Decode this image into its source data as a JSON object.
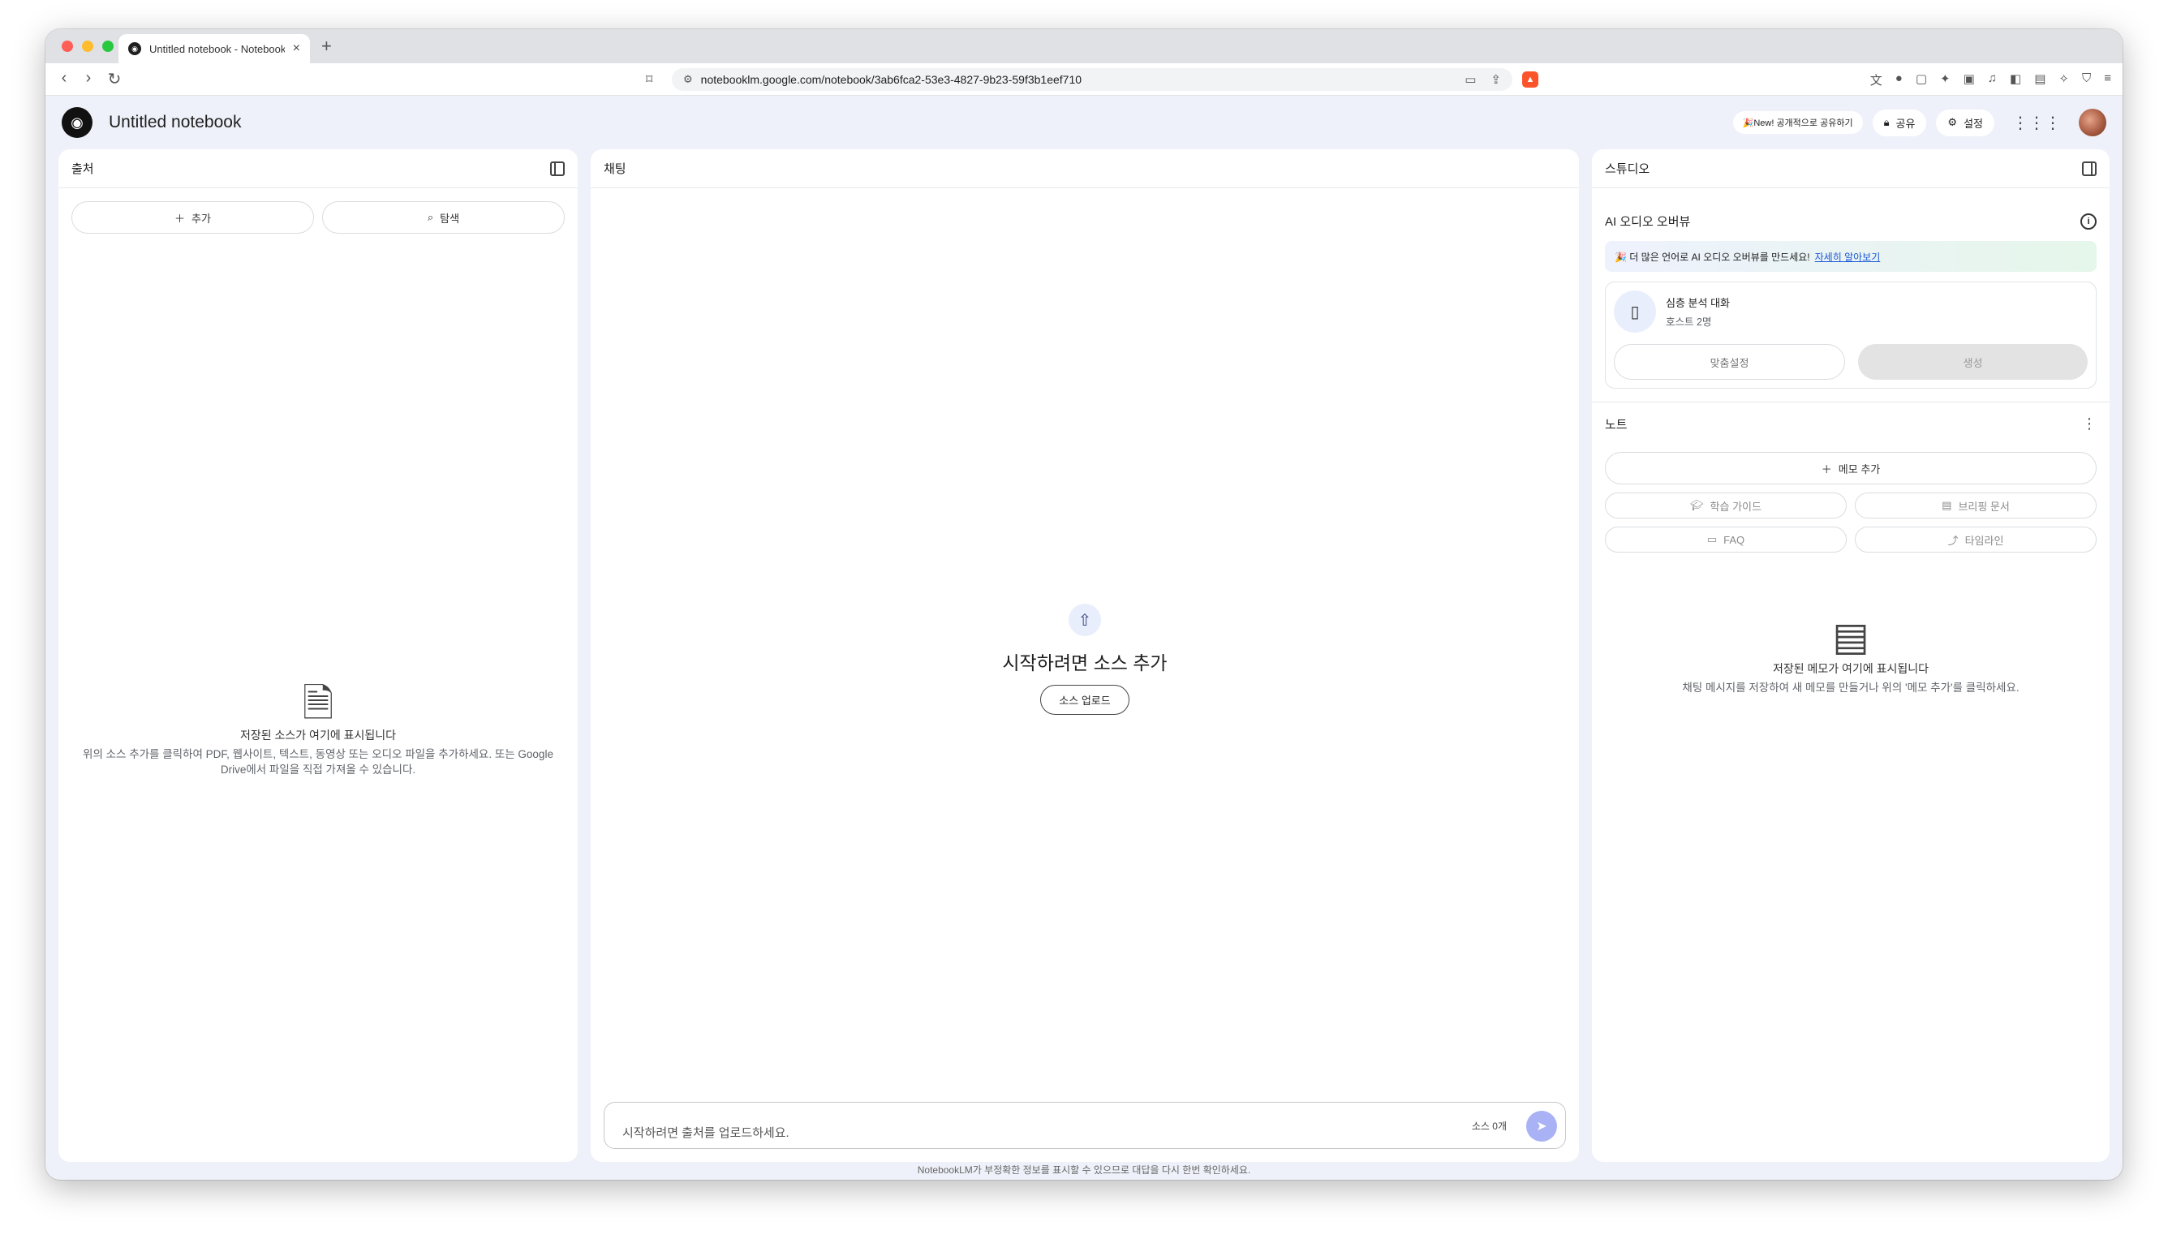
{
  "browser": {
    "tab_title": "Untitled notebook - NotebookLM",
    "tab_close": "×",
    "new_tab": "+",
    "url": "notebooklm.google.com/notebook/3ab6fca2-53e3-4827-9b23-59f3b1eef710"
  },
  "app": {
    "title": "Untitled notebook",
    "new_badge": "🎉New! 공개적으로 공유하기",
    "share_label": "공유",
    "settings_label": "설정"
  },
  "sources": {
    "header": "출처",
    "add_label": "추가",
    "explore_label": "탐색",
    "empty_title": "저장된 소스가 여기에 표시됩니다",
    "empty_sub": "위의 소스 추가를 클릭하여 PDF, 웹사이트, 텍스트, 동영상 또는 오디오 파일을 추가하세요. 또는 Google Drive에서 파일을 직접 가져올 수 있습니다."
  },
  "chat": {
    "header": "채팅",
    "start_title": "시작하려면 소스 추가",
    "upload_label": "소스 업로드",
    "input_placeholder": "시작하려면 출처를 업로드하세요.",
    "source_count": "소스 0개",
    "footer_note": "NotebookLM가 부정확한 정보를 표시할 수 있으므로 대답을 다시 한번 확인하세요."
  },
  "studio": {
    "header": "스튜디오",
    "audio_title": "AI 오디오 오버뷰",
    "banner_text": "🎉 더 많은 언어로 AI 오디오 오버뷰를 만드세요!",
    "banner_link": "자세히 알아보기",
    "audio_name": "심층 분석 대화",
    "audio_hosts": "호스트 2명",
    "customize_label": "맞춤설정",
    "generate_label": "생성",
    "notes_title": "노트",
    "add_memo_label": "메모 추가",
    "chips": [
      "학습 가이드",
      "브리핑 문서",
      "FAQ",
      "타임라인"
    ],
    "empty_title": "저장된 메모가 여기에 표시됩니다",
    "empty_sub": "채팅 메시지를 저장하여 새 메모를 만들거나 위의 '메모 추가'를 클릭하세요."
  }
}
